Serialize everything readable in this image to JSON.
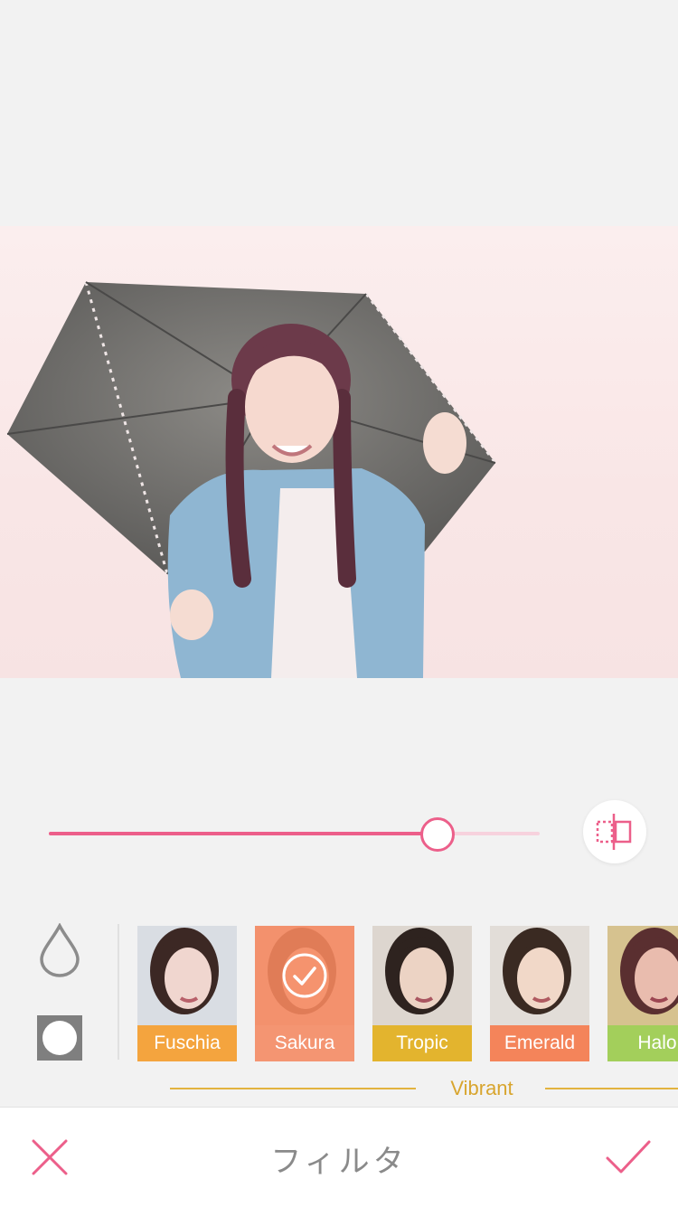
{
  "editor": {
    "title": "フィルタ",
    "intensity": 0.79
  },
  "filters": {
    "category": "Vibrant",
    "items": [
      {
        "label": "Fuschia",
        "color": "#f4a43e",
        "selected": false
      },
      {
        "label": "Sakura",
        "color": "#f48a5d",
        "selected": true
      },
      {
        "label": "Tropic",
        "color": "#e3b42e",
        "selected": false
      },
      {
        "label": "Emerald",
        "color": "#f4845a",
        "selected": false
      },
      {
        "label": "Halo",
        "color": "#a3cf5b",
        "selected": false
      }
    ]
  },
  "colors": {
    "accent": "#ec5f8a",
    "category": "#d8a52e"
  },
  "icons": {
    "cancel": "close-icon",
    "confirm": "checkmark-icon",
    "compare": "compare-split-icon",
    "droplet": "droplet-icon",
    "shape": "vignette-icon"
  }
}
